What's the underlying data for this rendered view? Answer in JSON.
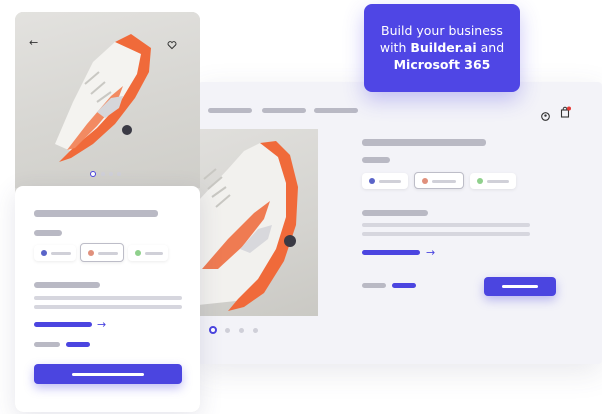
{
  "promo": {
    "line1": "Build your business",
    "line2_prefix": "with ",
    "line2_brand": "Builder.ai",
    "line2_suffix": " and",
    "line3": "Microsoft 365"
  },
  "icons": {
    "back": "back-arrow-icon",
    "favorite": "heart-icon",
    "account": "user-icon",
    "cart": "shopping-bag-icon",
    "link_arrow": "arrow-right-icon"
  },
  "glyphs": {
    "back": "←",
    "link_arrow": "→"
  },
  "colors": {
    "accent": "#4b45e0",
    "swatch_blue": "#5a64c8",
    "swatch_red": "#e0907c",
    "swatch_green": "#8fd08c",
    "shoe_orange": "#f06a3a"
  },
  "carousel": {
    "slides": 4,
    "active": 1
  }
}
